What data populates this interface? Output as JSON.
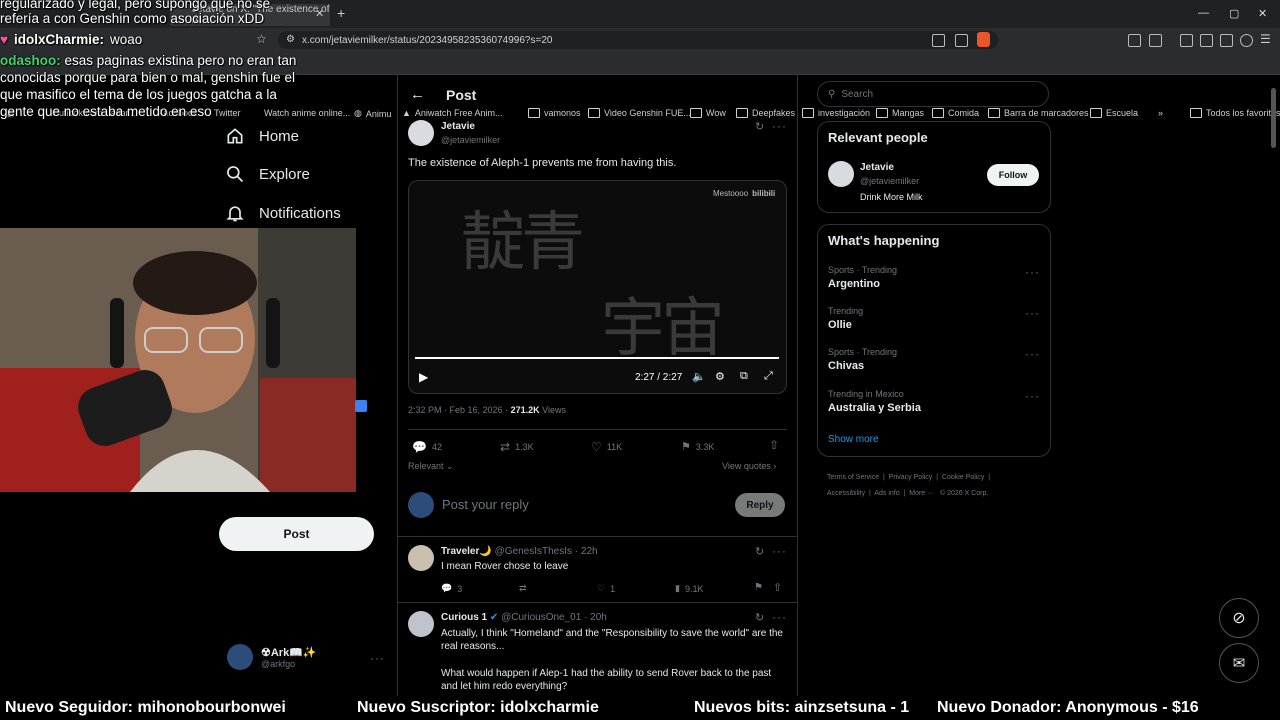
{
  "browser": {
    "tab_title": "Jetavie on X: \"The existence of Al",
    "url": "x.com/jetaviemilker/status/2023495823536074996?s=20",
    "bookmarks": [
      "Outlook.com - adan...",
      "Facebook",
      "Twitter",
      "Watch anime online...",
      "Animu",
      "Aniwatch Free Anim...",
      "vamonos",
      "Video Genshin FUE...",
      "Wow",
      "Deepfakes",
      "investigación",
      "Mangas",
      "Comida",
      "Barra de marcadores",
      "Escuela"
    ],
    "bookmarks_more": "»",
    "favorites": "Todos los favoritos"
  },
  "stream_overlay": {
    "chat": [
      {
        "user": "",
        "text": "regularizado y legal, pero supongo que no se"
      },
      {
        "user": "",
        "text": "refería a con Genshin como asociación xDD"
      },
      {
        "user": "idolxCharmie:",
        "text": "woao"
      },
      {
        "user": "odashoo:",
        "text": "esas paginas existina pero no eran tan conocidas porque para bien o mal, genshin fue el que masifico el tema de los juegos gatcha a la gente que no estaba metido en eso"
      }
    ],
    "ticker": [
      "Nuevo Seguidor: mihonobourbonwei",
      "Nuevo Suscriptor: idolxcharmie",
      "Nuevos bits: ainzsetsuna - 1",
      "Nuevo Donador: Anonymous - $16"
    ]
  },
  "nav": {
    "home": "Home",
    "explore": "Explore",
    "notifications": "Notifications",
    "post_button": "Post",
    "account_name": "☢Ark📖✨",
    "account_handle": "@arkfgo"
  },
  "post": {
    "header": "Post",
    "author_name": "Jetavie",
    "author_handle": "@jetaviemilker",
    "text": "The existence of Aleph-1 prevents me from having this.",
    "video": {
      "watermark": "Mestoooo",
      "watermark_brand": "bilibili",
      "calligraphy_line1": "靛青",
      "calligraphy_line2": "宇宙",
      "time": "2:27 / 2:27",
      "progress": 1.0
    },
    "timestamp": "2:32 PM · Feb 16, 2026 ·",
    "views_count": "271.2K",
    "views_label": "Views",
    "replies": "42",
    "reposts": "1.3K",
    "likes": "11K",
    "bookmarks": "3.3K",
    "sort": "Relevant",
    "view_quotes": "View quotes",
    "reply_placeholder": "Post your reply",
    "reply_button": "Reply"
  },
  "replies": [
    {
      "name": "Traveler🌙",
      "handle": "@GenesIsThesIs",
      "time": "· 22h",
      "text": "I mean Rover chose to leave",
      "comments": "3",
      "reposts": "",
      "likes": "1",
      "views": "9.1K"
    },
    {
      "name": "Curious 1",
      "handle": "@CuriousOne_01",
      "time": "· 20h",
      "text": "Actually, I think \"Homeland\" and the \"Responsibility to save the world\" are the real reasons...",
      "text2": "What would happen if Alep-1 had the ability to send Rover back to the past and let him redo everything?"
    }
  ],
  "sidebar": {
    "search_placeholder": "Search",
    "relevant_title": "Relevant people",
    "person_name": "Jetavie",
    "person_handle": "@jetaviemilker",
    "person_bio": "Drink More Milk",
    "follow": "Follow",
    "happening_title": "What's happening",
    "trends": [
      {
        "category": "Sports · Trending",
        "name": "Argentino"
      },
      {
        "category": "Trending",
        "name": "Ollie"
      },
      {
        "category": "Sports · Trending",
        "name": "Chivas"
      },
      {
        "category": "Trending in Mexico",
        "name": "Australia y Serbia"
      }
    ],
    "show_more": "Show more",
    "footer": [
      "Terms of Service",
      "Privacy Policy",
      "Cookie Policy",
      "Accessibility",
      "Ads info",
      "More ···",
      "© 2026 X Corp."
    ]
  },
  "colors": {
    "accent": "#1d9bf0",
    "background": "#000000",
    "border": "#2f3336",
    "muted": "#71767b"
  }
}
